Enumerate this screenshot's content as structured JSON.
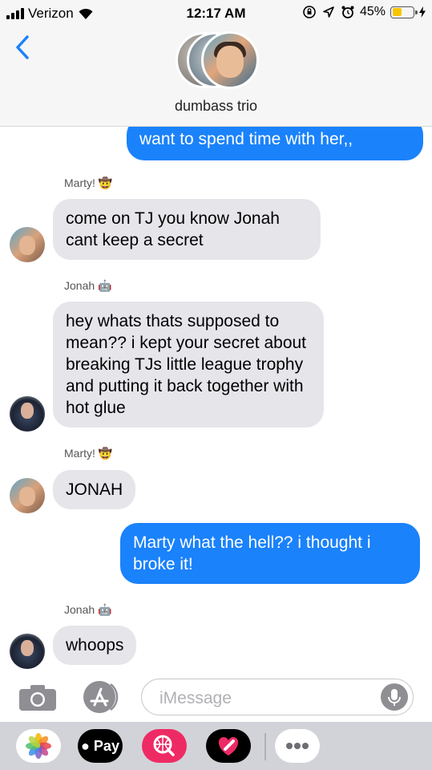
{
  "status_bar": {
    "carrier": "Verizon",
    "time": "12:17 AM",
    "battery_percent": "45%",
    "battery_level": 0.45,
    "icons": [
      "signal-bars-icon",
      "wifi-icon",
      "rotation-lock-icon",
      "location-icon",
      "alarm-icon",
      "battery-icon",
      "charging-bolt-icon"
    ]
  },
  "header": {
    "back_icon": "chevron-left-icon",
    "group_name": "dumbass trio"
  },
  "messages": [
    {
      "direction": "outgoing",
      "text": "want to spend time with her,,"
    },
    {
      "direction": "incoming",
      "sender": "Marty!",
      "sender_emoji": "🤠",
      "text": "come on TJ you know Jonah cant keep a secret"
    },
    {
      "direction": "incoming",
      "sender": "Jonah",
      "sender_emoji": "🤖",
      "text": "hey whats thats supposed to mean?? i kept your secret about breaking TJs little league trophy and putting it back together with hot glue"
    },
    {
      "direction": "incoming",
      "sender": "Marty!",
      "sender_emoji": "🤠",
      "text": "JONAH"
    },
    {
      "direction": "outgoing",
      "text": "Marty what the hell?? i thought i broke it!"
    },
    {
      "direction": "incoming",
      "sender": "Jonah",
      "sender_emoji": "🤖",
      "text": "whoops"
    }
  ],
  "compose": {
    "placeholder": "iMessage",
    "camera_icon": "camera-icon",
    "appstore_icon": "app-store-icon",
    "mic_icon": "microphone-icon"
  },
  "app_drawer": {
    "apple_pay_label": "Pay",
    "apps": [
      "photos-icon",
      "apple-pay-icon",
      "web-search-icon",
      "digital-touch-heart-icon",
      "more-icon"
    ]
  },
  "colors": {
    "outgoing_bubble": "#1a82fb",
    "incoming_bubble": "#e6e5ea",
    "accent": "#1a82fb",
    "battery": "#f6c500"
  }
}
